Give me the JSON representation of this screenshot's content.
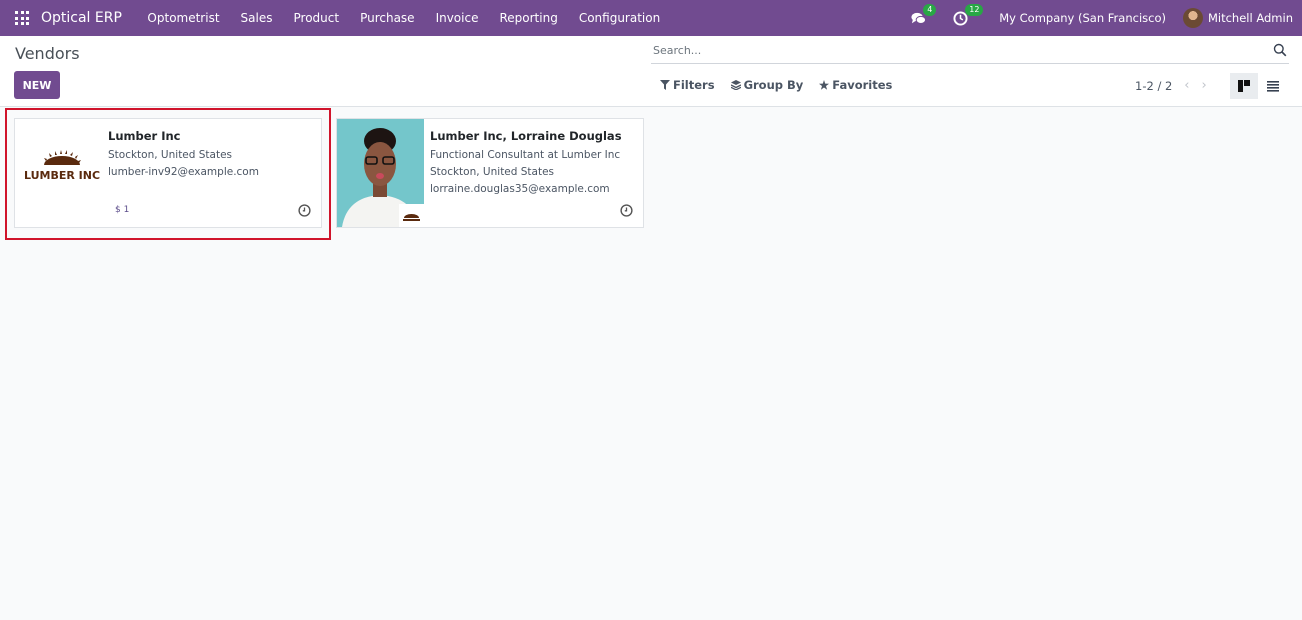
{
  "navbar": {
    "app_name": "Optical ERP",
    "menus": [
      "Optometrist",
      "Sales",
      "Product",
      "Purchase",
      "Invoice",
      "Reporting",
      "Configuration"
    ],
    "messages_count": "4",
    "activities_count": "12",
    "company": "My Company (San Francisco)",
    "user": "Mitchell Admin",
    "accent_color": "#714b90"
  },
  "control_panel": {
    "title": "Vendors",
    "new_label": "NEW",
    "search_placeholder": "Search...",
    "filters_label": "Filters",
    "group_by_label": "Group By",
    "favorites_label": "Favorites",
    "pager": "1-2 / 2"
  },
  "cards": [
    {
      "name": "Lumber Inc",
      "logo_text": "LUMBER INC",
      "address": "Stockton, United States",
      "email": "lumber-inv92@example.com",
      "tag": "$ 1"
    },
    {
      "name": "Lumber Inc, Lorraine Douglas",
      "job": "Functional Consultant at Lumber Inc",
      "address": "Stockton, United States",
      "email": "lorraine.douglas35@example.com"
    }
  ]
}
